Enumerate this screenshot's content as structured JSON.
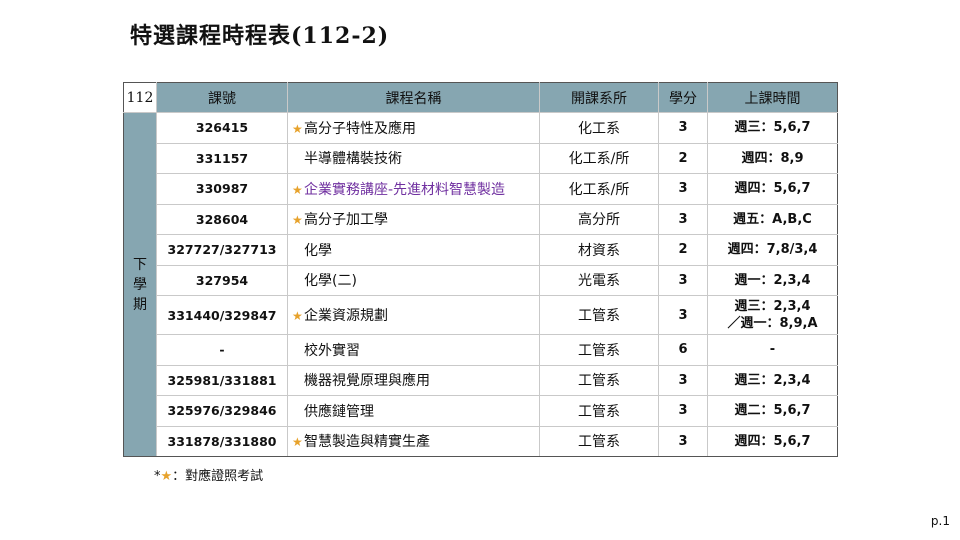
{
  "title": "特選課程時程表(112-2)",
  "table": {
    "year": "112",
    "term": "下學期",
    "headers": [
      "課號",
      "課程名稱",
      "開課系所",
      "學分",
      "上課時間"
    ],
    "rows": [
      {
        "code": "326415",
        "star": true,
        "name": "高分子特性及應用",
        "dept": "化工系",
        "credit": "3",
        "time": [
          "週三：5,6,7"
        ]
      },
      {
        "code": "331157",
        "star": false,
        "name": "半導體構裝技術",
        "dept": "化工系/所",
        "credit": "2",
        "time": [
          "週四：8,9"
        ]
      },
      {
        "code": "330987",
        "star": true,
        "name": "企業實務講座-先進材料智慧製造",
        "dept": "化工系/所",
        "credit": "3",
        "time": [
          "週四：5,6,7"
        ],
        "highlight": true
      },
      {
        "code": "328604",
        "star": true,
        "name": "高分子加工學",
        "dept": "高分所",
        "credit": "3",
        "time": [
          "週五：A,B,C"
        ]
      },
      {
        "code": "327727/327713",
        "star": false,
        "name": "化學",
        "dept": "材資系",
        "credit": "2",
        "time": [
          "週四：7,8/3,4"
        ]
      },
      {
        "code": "327954",
        "star": false,
        "name": "化學(二)",
        "dept": "光電系",
        "credit": "3",
        "time": [
          "週一：2,3,4"
        ]
      },
      {
        "code": "331440/329847",
        "star": true,
        "name": "企業資源規劃",
        "dept": "工管系",
        "credit": "3",
        "time": [
          "週三：2,3,4",
          "／週一：8,9,A"
        ]
      },
      {
        "code": "-",
        "star": false,
        "name": "校外實習",
        "dept": "工管系",
        "credit": "6",
        "time": [
          "-"
        ]
      },
      {
        "code": "325981/331881",
        "star": false,
        "name": "機器視覺原理與應用",
        "dept": "工管系",
        "credit": "3",
        "time": [
          "週三：2,3,4"
        ]
      },
      {
        "code": "325976/329846",
        "star": false,
        "name": "供應鏈管理",
        "dept": "工管系",
        "credit": "3",
        "time": [
          "週二：5,6,7"
        ]
      },
      {
        "code": "331878/331880",
        "star": true,
        "name": "智慧製造與精實生產",
        "dept": "工管系",
        "credit": "3",
        "time": [
          "週四：5,6,7"
        ]
      }
    ]
  },
  "note": {
    "prefix": "*",
    "star": "★",
    "text": "：對應證照考試"
  },
  "page_number": "p.1",
  "colors": {
    "header_bg": "#86a6b1",
    "star": "#e7a22b",
    "highlight_text": "#7030a0"
  }
}
